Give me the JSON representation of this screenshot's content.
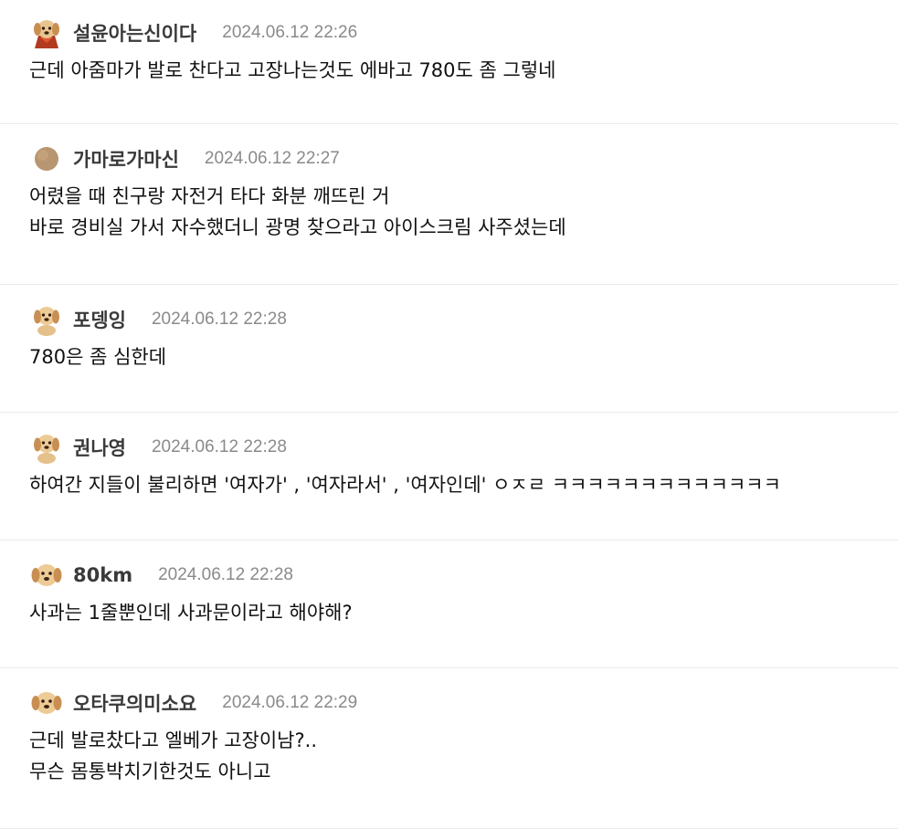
{
  "comments": [
    {
      "author": "설윤아는신이다",
      "timestamp": "2024.06.12 22:26",
      "avatar_icon": "dog-with-cape-icon",
      "lines": [
        "근데 아줌마가 발로 찬다고 고장나는것도 에바고 780도 좀 그렇네"
      ]
    },
    {
      "author": "가마로가마신",
      "timestamp": "2024.06.12 22:27",
      "avatar_icon": "brown-circle-icon",
      "lines": [
        "어렸을 때 친구랑 자전거 타다 화분 깨뜨린 거",
        "바로 경비실 가서 자수했더니 광명 찾으라고 아이스크림 사주셨는데"
      ]
    },
    {
      "author": "포뎅잉",
      "timestamp": "2024.06.12 22:28",
      "avatar_icon": "puppy-icon",
      "lines": [
        "780은 좀 심한데"
      ]
    },
    {
      "author": "권나영",
      "timestamp": "2024.06.12 22:28",
      "avatar_icon": "puppy-icon",
      "lines": [
        "하여간 지들이 불리하면 '여자가' , '여자라서' , '여자인데' ㅇㅈㄹ ㅋㅋㅋㅋㅋㅋㅋㅋㅋㅋㅋㅋㅋ"
      ]
    },
    {
      "author": "80km",
      "timestamp": "2024.06.12 22:28",
      "avatar_icon": "puppy-face-icon",
      "lines": [
        "사과는 1줄뿐인데 사과문이라고 해야해?"
      ]
    },
    {
      "author": "오타쿠의미소요",
      "timestamp": "2024.06.12 22:29",
      "avatar_icon": "puppy-face-icon",
      "lines": [
        "근데 발로찼다고 엘베가 고장이남?..",
        "무슨 몸통박치기한것도 아니고"
      ]
    }
  ]
}
